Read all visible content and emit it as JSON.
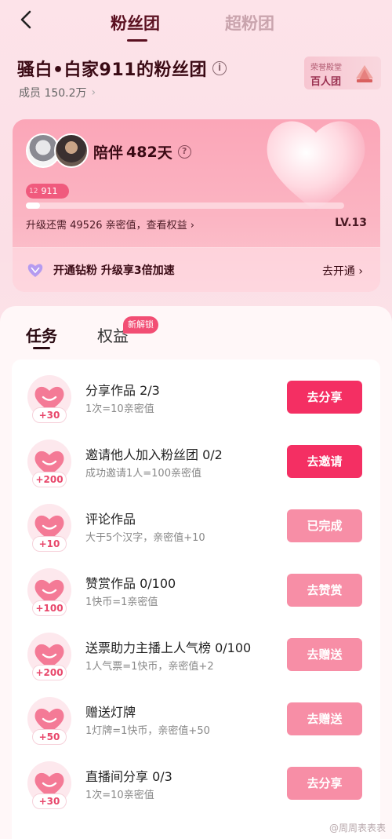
{
  "nav": {
    "tab_fans": "粉丝团",
    "tab_super": "超粉团"
  },
  "header": {
    "title": "骚白•白家911的粉丝团",
    "members": "成员 150.2万",
    "honor_top": "荣誉殿堂",
    "honor_main": "百人团"
  },
  "card": {
    "companion_prefix": "陪伴",
    "companion_days": "482",
    "companion_suffix": "天",
    "level_pill": "911",
    "level_pill_num": "12",
    "progress_fraction": 0.045,
    "upgrade_text": "升级还需 49526 亲密值，查看权益 ›",
    "level": "LV.13",
    "diamond_text": "开通钻粉  升级享3倍加速",
    "diamond_go": "去开通 ›"
  },
  "panel": {
    "tab_tasks": "任务",
    "tab_rights": "权益",
    "new_badge": "新解锁"
  },
  "tasks": [
    {
      "plus": "+30",
      "title": "分享作品  2/3",
      "sub": "1次=10亲密值",
      "btn": "去分享",
      "style": "strong"
    },
    {
      "plus": "+200",
      "title": "邀请他人加入粉丝团  0/2",
      "sub": "成功邀请1人=100亲密值",
      "btn": "去邀请",
      "style": "strong"
    },
    {
      "plus": "+10",
      "title": "评论作品",
      "sub": "大于5个汉字，亲密值+10",
      "btn": "已完成",
      "style": "soft"
    },
    {
      "plus": "+100",
      "title": "赞赏作品  0/100",
      "sub": "1快币=1亲密值",
      "btn": "去赞赏",
      "style": "soft"
    },
    {
      "plus": "+200",
      "title": "送票助力主播上人气榜  0/100",
      "sub": "1人气票=1快币，亲密值+2",
      "btn": "去赠送",
      "style": "soft"
    },
    {
      "plus": "+50",
      "title": "赠送灯牌",
      "sub": "1灯牌=1快币，亲密值+50",
      "btn": "去赠送",
      "style": "soft"
    },
    {
      "plus": "+30",
      "title": "直播间分享  0/3",
      "sub": "1次=10亲密值",
      "btn": "去分享",
      "style": "soft"
    }
  ],
  "watermark": "@周周表表表",
  "colors": {
    "accent": "#f42f63",
    "accent_soft": "#f78ea6",
    "card": "#fba6b8",
    "title": "#3a0a14"
  }
}
